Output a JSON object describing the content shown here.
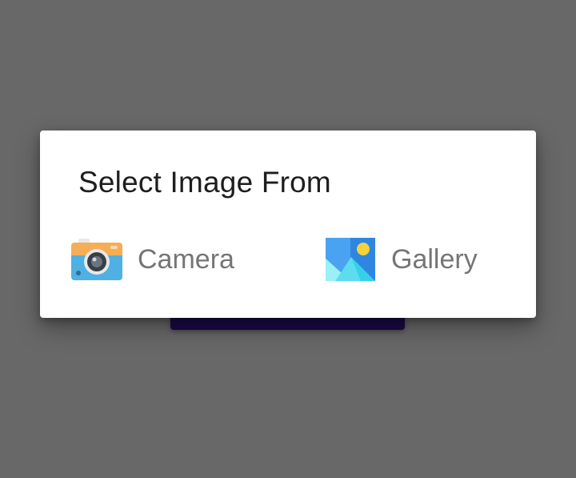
{
  "dialog": {
    "title": "Select Image From",
    "options": [
      {
        "label": "Camera",
        "icon": "camera-icon"
      },
      {
        "label": "Gallery",
        "icon": "gallery-icon"
      }
    ]
  },
  "colors": {
    "scrim": "#686868",
    "dialog_background": "#ffffff",
    "title_text": "#1e1e1e",
    "option_text": "#757575",
    "underlying_button": "#1b0a4a"
  }
}
